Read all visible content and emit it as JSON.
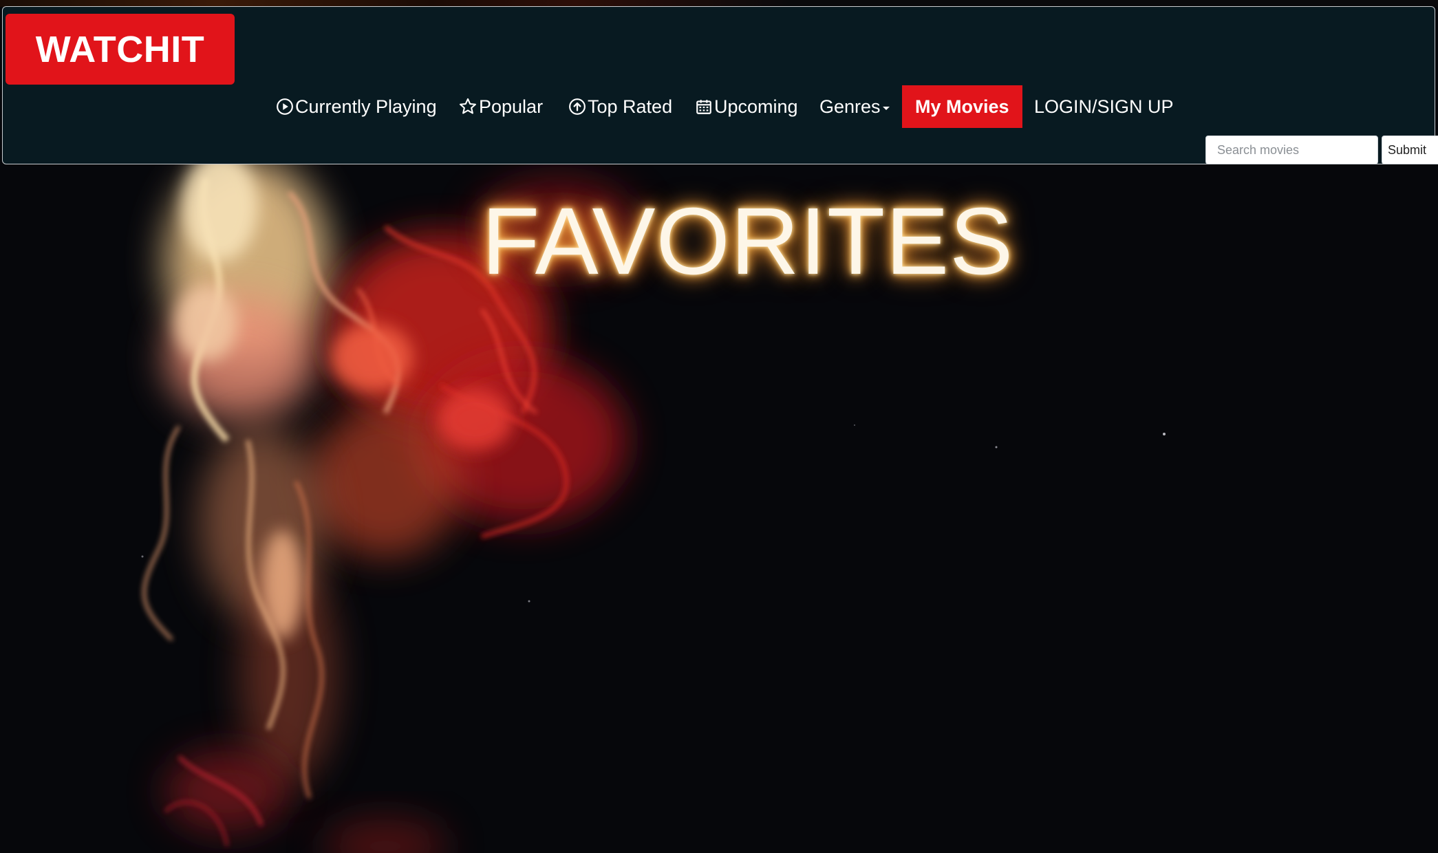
{
  "brand": {
    "name": "WATCHIT"
  },
  "nav": {
    "items": [
      {
        "label": "Currently Playing",
        "icon": "play-circle-icon"
      },
      {
        "label": "Popular",
        "icon": "star-outline-icon"
      },
      {
        "label": "Top Rated",
        "icon": "arrow-up-circle-icon"
      },
      {
        "label": "Upcoming",
        "icon": "calendar-icon"
      },
      {
        "label": "Genres",
        "icon": "caret-down-icon"
      },
      {
        "label": "My Movies",
        "active": true
      },
      {
        "label": "LOGIN/SIGN UP"
      }
    ]
  },
  "search": {
    "placeholder": "Search movies",
    "value": "",
    "submit_label": "Submit"
  },
  "hero": {
    "title": "FAVORITES"
  },
  "colors": {
    "navbar_bg": "#081a21",
    "accent_red": "#e1141a",
    "page_bg": "#06070b",
    "title_glow": "#ffbf5a"
  }
}
